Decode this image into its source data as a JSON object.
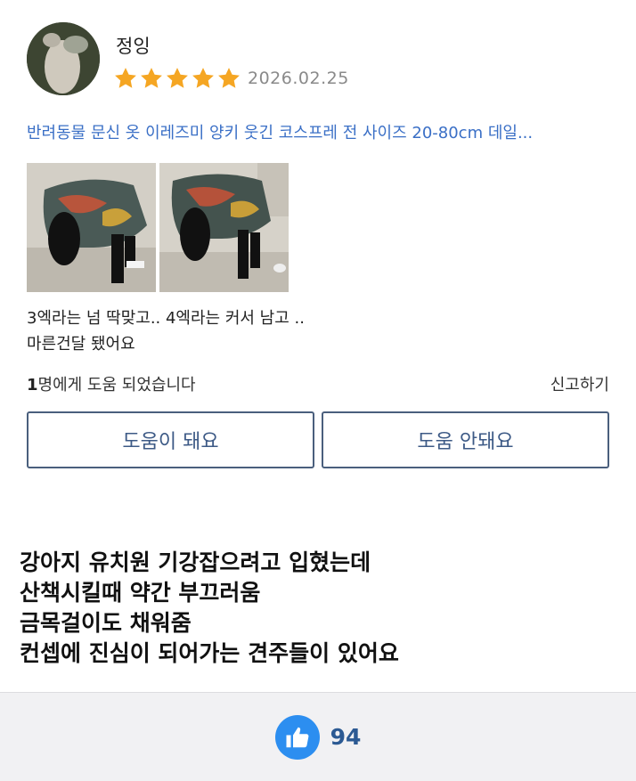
{
  "review": {
    "username": "정잉",
    "rating": 5,
    "rating_max": 5,
    "date": "2026.02.25",
    "product_title": "반려동물 문신 옷 이레즈미 양키 웃긴 코스프레 전 사이즈 20-80cm 데일...",
    "photos_count": 2,
    "text_lines": [
      "3엑라는 넘 딱맞고.. 4엑라는 커서 남고 ..",
      "마른건달 됐어요"
    ],
    "helpful": {
      "count": "1",
      "suffix": "명에게 도움 되었습니다"
    },
    "report_label": "신고하기",
    "vote_yes_label": "도움이 돼요",
    "vote_no_label": "도움 안돼요"
  },
  "caption_lines": [
    "강아지 유치원 기강잡으려고 입혔는데",
    "산책시킬때 약간 부끄러움",
    "금목걸이도 채워줌",
    "컨셉에 진심이 되어가는 견주들이 있어요"
  ],
  "footer": {
    "like_icon": "thumbs-up-icon",
    "like_count": "94"
  },
  "colors": {
    "star": "#f5a623",
    "link": "#3a6fc6",
    "button_text": "#3d5a86",
    "like": "#2c8ef0"
  }
}
